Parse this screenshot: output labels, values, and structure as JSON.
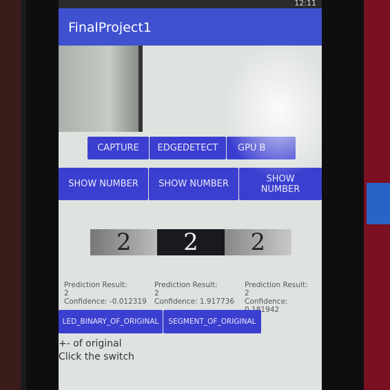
{
  "status_bar": {
    "time": "12:11"
  },
  "app": {
    "title": "FinalProject1",
    "accent": "#3f51cf"
  },
  "row1": [
    "CAPTURE",
    "EDGEDETECT",
    "GPU B"
  ],
  "row2": [
    "SHOW NUMBER",
    "SHOW NUMBER",
    "SHOW NUMBER"
  ],
  "digits": [
    "2",
    "2",
    "2"
  ],
  "predictions": [
    {
      "label": "Prediction Result:",
      "value": "2",
      "confidence": "Confidence: -0.012319"
    },
    {
      "label": "Prediction Result:",
      "value": "2",
      "confidence": "Confidence: 1.917736"
    },
    {
      "label": "Prediction Result:",
      "value": "2",
      "confidence": "Confidence: 0.181942"
    }
  ],
  "row3": [
    "LED_BINARY_OF_ORIGINAL",
    "SEGMENT_OF_ORIGINAL"
  ],
  "notes": [
    "+- of original",
    "Click the switch"
  ]
}
